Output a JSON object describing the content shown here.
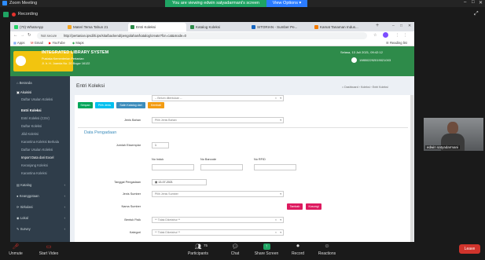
{
  "zoom": {
    "title": "Zoom Meeting",
    "recording": "Recording",
    "viewing_banner": "You are viewing edwin satyadarmani's screen",
    "view_options": "View Options",
    "controls": {
      "unmute": "Unmute",
      "start_video": "Start Video",
      "participants": "Participants",
      "participants_count": "75",
      "chat": "Chat",
      "share_screen": "Share Screen",
      "record": "Record",
      "reactions": "Reactions",
      "leave": "Leave"
    },
    "video_tile_name": "edwin satyadarmani",
    "accent_green": "#1fa463",
    "leave_color": "#d0342c"
  },
  "browser": {
    "tabs": [
      {
        "label": "(70) WhatsApp",
        "color": "#25d366"
      },
      {
        "label": "Materi Tema Tahun 21",
        "color": "#f5a623"
      },
      {
        "label": "Entri Koleksi",
        "color": "#2e8b4a"
      },
      {
        "label": "Katalog Koleksi",
        "color": "#2e8b4a"
      },
      {
        "label": "SITORIAN - Sumber Pe...",
        "color": "#1565c0"
      },
      {
        "label": "Kamat Tanaman Indus...",
        "color": "#f57c00"
      }
    ],
    "url": "http://pertanian.ipsdi/ti.ips/sita/backend/pengolahan/katalog/create?for=cat&mode=0",
    "not_secure": "Not secure",
    "bookmarks": [
      "Apps",
      "Gmail",
      "YouTube",
      "Maps"
    ],
    "reading_list": "Reading list"
  },
  "app": {
    "system_name": "INTEGRATED LIBRARY SYSTEM",
    "institution": "Pustaka Kementerian Pertanian",
    "address": "Jl. Ir. H. Juanda No. 20 Bogor 16122",
    "date": "Selasa, 13 Juli 2021, 09:42:12",
    "user_id": "198502292019021003",
    "header_color": "#2e8b4a"
  },
  "sidebar": {
    "items": [
      {
        "label": "Beranda"
      },
      {
        "label": "Akuisisi"
      },
      {
        "label": "Katalog"
      },
      {
        "label": "Keanggotaan"
      },
      {
        "label": "Sirkulasi"
      },
      {
        "label": "Lokal"
      },
      {
        "label": "Survey"
      }
    ],
    "subitems": [
      "Daftar Usulan Koleksi",
      "Entri Koleksi",
      "Entri Koleksi (CSV)",
      "Daftar Koleksi",
      "Jilid Koleksi",
      "Karantina Koleksi Berkala",
      "Daftar Usulan Koleksi",
      "Import Data dari Excel",
      "Keranjang Koleksi",
      "Karantina Koleksi"
    ]
  },
  "main": {
    "page_title": "Entri Koleksi",
    "breadcrumb": [
      "Dashboard",
      "Koleksi",
      "Entri Koleksi"
    ],
    "buttons": {
      "simpan": "Simpan",
      "pilih_jenis": "Pilih Jenis",
      "salin_katalog": "Salin Katalog dari",
      "kembali": "Kembali"
    },
    "jenis_bahan_label": "Jenis Bahan",
    "jenis_bahan_placeholder": "Pilih Jenis Bahan",
    "section_title": "Data Pengadaan",
    "jumlah_eksemplar_label": "Jumlah Eksemplar",
    "jumlah_eksemplar_value": "1",
    "no_induk_label": "No Induk",
    "no_barcode_label": "No Barcode",
    "no_rfid_label": "No RFID",
    "no_induk_value": "",
    "no_barcode_value": "",
    "no_rfid_value": "",
    "tanggal_label": "Tanggal Pengadaan",
    "tanggal_value": "13-07-2021",
    "jenis_sumber_label": "Jenis Sumber",
    "jenis_sumber_placeholder": "Pilih Jenis Sumber",
    "nama_sumber_label": "Nama Sumber",
    "nama_sumber_placeholder": "-- Belum ditentukan --",
    "tambah_label": "Tambah",
    "kosongi_label": "Kosongi",
    "bentuk_fisik_label": "Bentuk Fisik",
    "bentuk_fisik_placeholder": "** Tidak Diketahui **",
    "kategori_label": "Kategori",
    "kategori_placeholder": "** Tidak Diketahui **"
  }
}
